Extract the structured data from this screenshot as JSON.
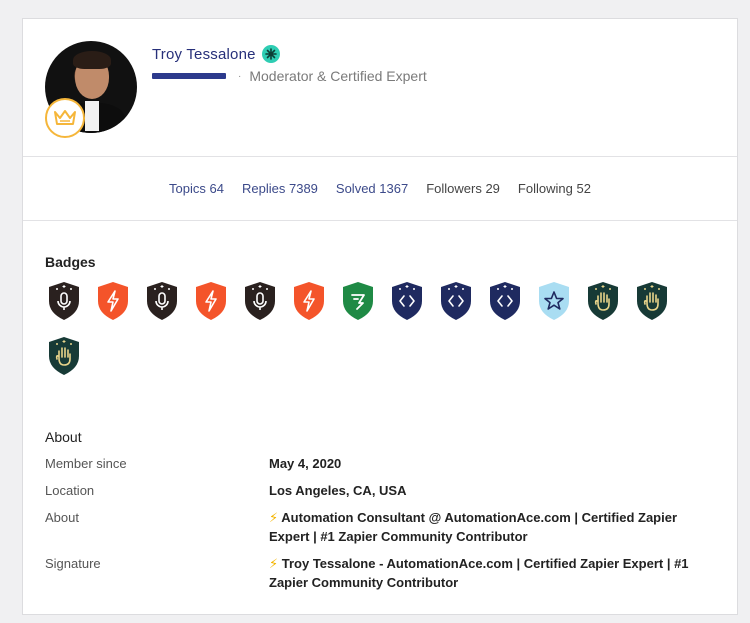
{
  "profile": {
    "name": "Troy Tessalone",
    "role": "Moderator & Certified Expert",
    "role_separator": "·"
  },
  "stats": [
    {
      "label": "Topics",
      "value": "64",
      "link": true
    },
    {
      "label": "Replies",
      "value": "7389",
      "link": true
    },
    {
      "label": "Solved",
      "value": "1367",
      "link": true
    },
    {
      "label": "Followers",
      "value": "29",
      "link": false
    },
    {
      "label": "Following",
      "value": "52",
      "link": false
    }
  ],
  "badges_section": {
    "title": "Badges",
    "badges": [
      {
        "icon": "microphone-icon",
        "color": "#2a211f"
      },
      {
        "icon": "lightning-icon",
        "color": "#f4542a"
      },
      {
        "icon": "microphone-icon",
        "color": "#2a211f"
      },
      {
        "icon": "lightning-icon",
        "color": "#f4542a"
      },
      {
        "icon": "microphone-icon",
        "color": "#2a211f"
      },
      {
        "icon": "lightning-icon",
        "color": "#f4542a"
      },
      {
        "icon": "zapier-icon",
        "color": "#1f8a45"
      },
      {
        "icon": "code-icon",
        "color": "#1f2a60"
      },
      {
        "icon": "code-icon",
        "color": "#1f2a60"
      },
      {
        "icon": "code-icon",
        "color": "#1f2a60"
      },
      {
        "icon": "star-icon",
        "color": "#a9ddf2"
      },
      {
        "icon": "hand-icon",
        "color": "#173a36"
      },
      {
        "icon": "hand-icon",
        "color": "#173a36"
      },
      {
        "icon": "hand-icon",
        "color": "#173a36"
      }
    ]
  },
  "about_section": {
    "title": "About",
    "rows": [
      {
        "label": "Member since",
        "value": "May 4, 2020",
        "bolt": false
      },
      {
        "label": "Location",
        "value": "Los Angeles, CA, USA",
        "bolt": false
      },
      {
        "label": "About",
        "value": "Automation Consultant @ AutomationAce.com | Certified Zapier Expert | #1 Zapier Community Contributor",
        "bolt": true
      },
      {
        "label": "Signature",
        "value": "Troy Tessalone - AutomationAce.com | Certified Zapier Expert | #1 Zapier Community Contributor",
        "bolt": true
      }
    ]
  },
  "colors": {
    "link": "#3c4a8a",
    "name": "#27307a",
    "role_bar": "#2c3a8c",
    "verified": "#2ecdb3",
    "rank_ring": "#f5b63a",
    "bolt": "#f3b400"
  }
}
